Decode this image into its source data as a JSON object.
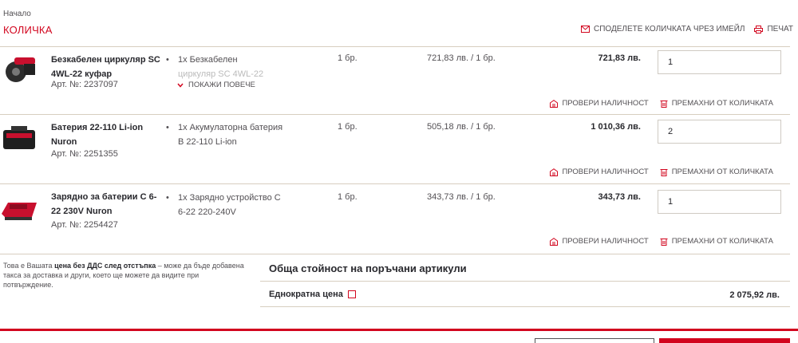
{
  "breadcrumb": "Начало",
  "page_title": "КОЛИЧКА",
  "top_actions": {
    "share_email": "СПОДЕЛЕТЕ КОЛИЧКАТА ЧРЕЗ ИМЕЙЛ",
    "print": "ПЕЧАТ"
  },
  "items": [
    {
      "name": "Безкабелен циркуляр SC 4WL-22 куфар",
      "art_no": "Арт. №: 2237097",
      "desc_line": "1x Безкабелен",
      "desc_faded": "циркуляр SC 4WL-22",
      "show_more": "ПОКАЖИ ПОВЕЧЕ",
      "qty_text": "1 бр.",
      "unit_price": "721,83 лв. / 1 бр.",
      "total": "721,83 лв.",
      "qty_value": "1",
      "check_availability": "ПРОВЕРИ НАЛИЧНОСТ",
      "remove": "ПРЕМАХНИ ОТ КОЛИЧКАТА"
    },
    {
      "name": "Батерия 22-110 Li-ion Nuron",
      "art_no": "Арт. №: 2251355",
      "desc_line": "1x Акумулаторна батерия B 22-110 Li-ion",
      "qty_text": "1 бр.",
      "unit_price": "505,18 лв. / 1 бр.",
      "total": "1 010,36 лв.",
      "qty_value": "2",
      "check_availability": "ПРОВЕРИ НАЛИЧНОСТ",
      "remove": "ПРЕМАХНИ ОТ КОЛИЧКАТА"
    },
    {
      "name": "Зарядно за батерии C 6-22 230V Nuron",
      "art_no": "Арт. №: 2254427",
      "desc_line": "1x Зарядно устройство C 6-22 220-240V",
      "qty_text": "1 бр.",
      "unit_price": "343,73 лв. / 1 бр.",
      "total": "343,73 лв.",
      "qty_value": "1",
      "check_availability": "ПРОВЕРИ НАЛИЧНОСТ",
      "remove": "ПРЕМАХНИ ОТ КОЛИЧКАТА"
    }
  ],
  "note": {
    "pre": "Това е Вашата ",
    "bold": "цена без ДДС след отстъпка",
    "post": " – може да бъде добавена такса за доставка и други, което ще можете да видите при потвърждение."
  },
  "summary": {
    "title": "Обща стойност на поръчани артикули",
    "one_time_label": "Еднократна цена",
    "one_time_value": "2 075,92 лв."
  },
  "colors": {
    "accent": "#d2051e",
    "text": "#524f53",
    "divider": "#d7cebf"
  }
}
